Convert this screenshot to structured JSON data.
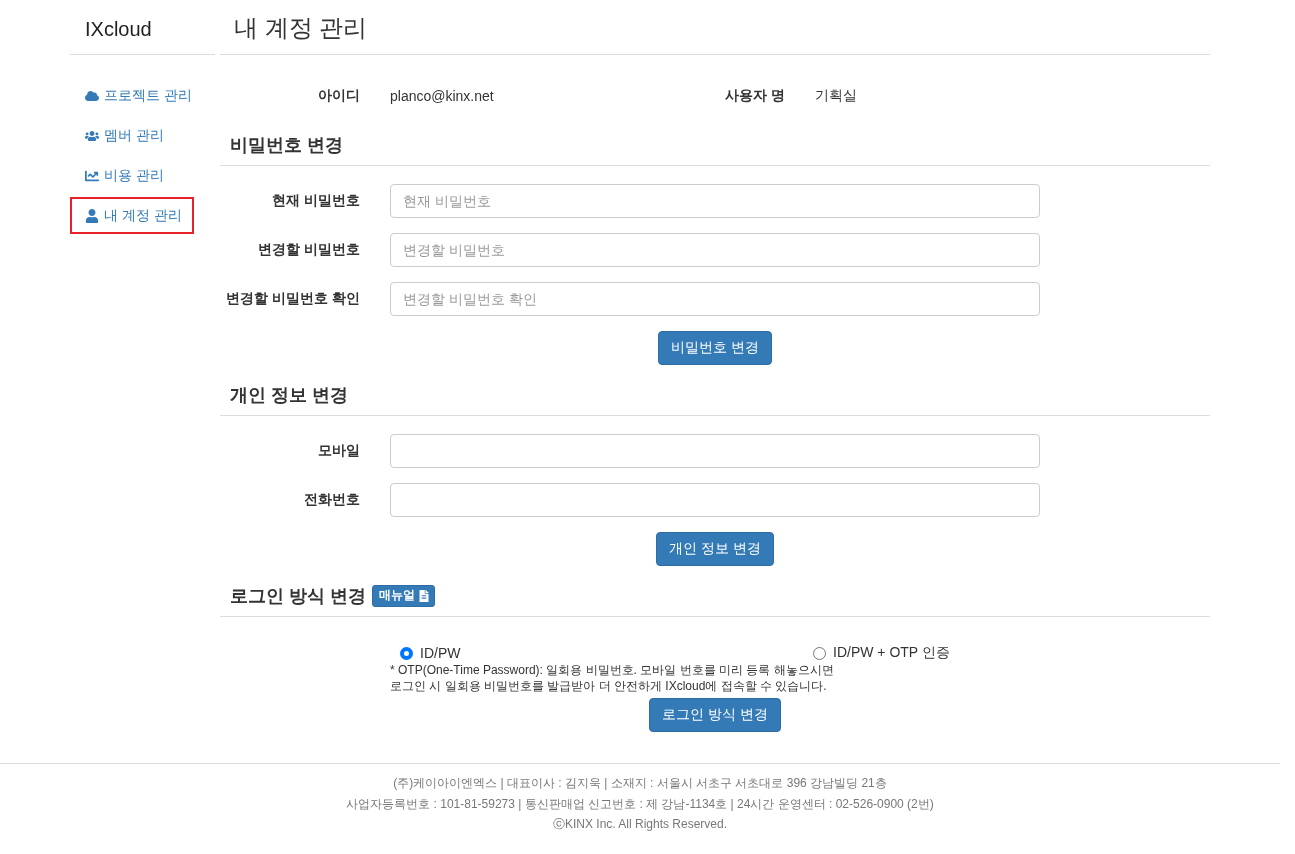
{
  "brand": "IXcloud",
  "sidebar": {
    "items": [
      {
        "label": "프로젝트 관리",
        "selected": false
      },
      {
        "label": "멤버 관리",
        "selected": false
      },
      {
        "label": "비용 관리",
        "selected": false
      },
      {
        "label": "내 계정 관리",
        "selected": true
      }
    ]
  },
  "page_title": "내 계정 관리",
  "account": {
    "fields": [
      {
        "label": "아이디",
        "value": "planco@kinx.net"
      },
      {
        "label": "사용자 명",
        "value": "기획실"
      }
    ]
  },
  "sections": [
    {
      "title": "비밀번호 변경",
      "fields": [
        {
          "label": "현재 비밀번호",
          "placeholder": "현재 비밀번호"
        },
        {
          "label": "변경할 비밀번호",
          "placeholder": "변경할 비밀번호"
        },
        {
          "label": "변경할 비밀번호 확인",
          "placeholder": "변경할 비밀번호 확인"
        }
      ],
      "button": "비밀번호 변경"
    },
    {
      "title": "개인 정보 변경",
      "fields": [
        {
          "label": "모바일"
        },
        {
          "label": "전화번호"
        }
      ],
      "button": "개인 정보 변경"
    }
  ],
  "login_method": {
    "title": "로그인 방식 변경",
    "manual_button": "매뉴얼",
    "options": [
      {
        "label": "ID/PW",
        "selected": true
      },
      {
        "label": "ID/PW + OTP 인증",
        "selected": false
      }
    ],
    "note": "* OTP(One-Time Password): 일회용 비밀번호. 모바일 번호를 미리 등록 해놓으시면\n로그인 시 일회용 비밀번호를 발급받아 더 안전하게 IXcloud에 접속할 수 있습니다.",
    "button": "로그인 방식 변경"
  },
  "footer": {
    "lines": [
      "(주)케이아이엔엑스 | 대표이사 : 김지욱 | 소재지 : 서울시 서초구 서초대로 396 강남빌딩 21층",
      "사업자등록번호 : 101-81-59273 | 통신판매업 신고번호 : 제 강남-1134호 | 24시간 운영센터 : 02-526-0900 (2번)",
      "ⓒKINX Inc. All Rights Reserved."
    ]
  }
}
